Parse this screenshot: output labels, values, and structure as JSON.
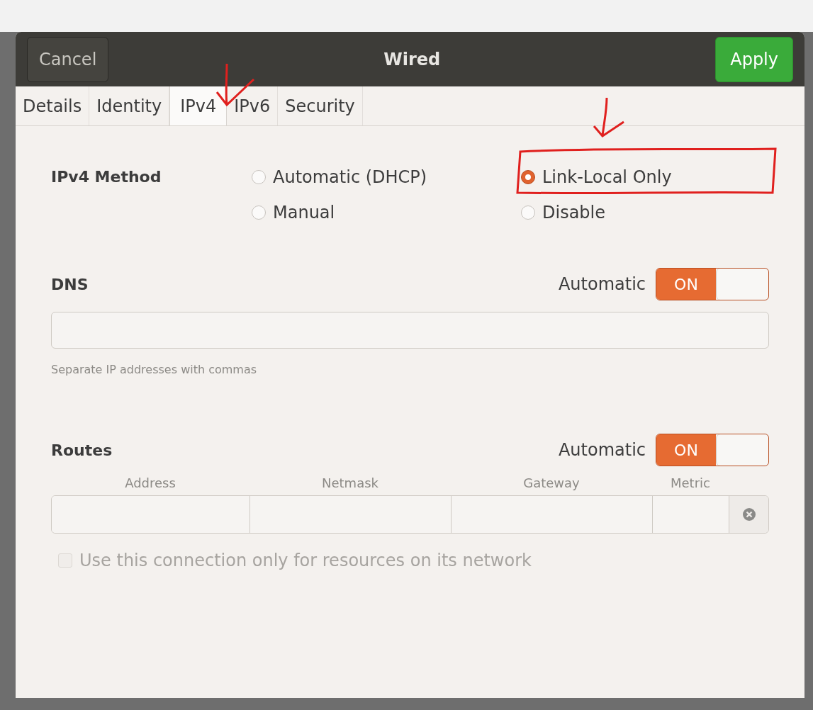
{
  "window": {
    "title": "Wired",
    "cancel": "Cancel",
    "apply": "Apply"
  },
  "tabs": [
    {
      "label": "Details",
      "selected": false
    },
    {
      "label": "Identity",
      "selected": false
    },
    {
      "label": "IPv4",
      "selected": true
    },
    {
      "label": "IPv6",
      "selected": false
    },
    {
      "label": "Security",
      "selected": false
    }
  ],
  "ipv4_method": {
    "label": "IPv4 Method",
    "options": [
      {
        "label": "Automatic (DHCP)",
        "selected": false
      },
      {
        "label": "Link-Local Only",
        "selected": true
      },
      {
        "label": "Manual",
        "selected": false
      },
      {
        "label": "Disable",
        "selected": false
      }
    ]
  },
  "dns": {
    "label": "DNS",
    "automatic_label": "Automatic",
    "toggle": {
      "label": "ON",
      "on": true
    },
    "hint": "Separate IP addresses with commas"
  },
  "routes": {
    "label": "Routes",
    "automatic_label": "Automatic",
    "toggle": {
      "label": "ON",
      "on": true
    },
    "columns": [
      "Address",
      "Netmask",
      "Gateway",
      "Metric"
    ],
    "only_local": {
      "label": "Use this connection only for resources on its network",
      "checked": false,
      "disabled": true
    }
  }
}
